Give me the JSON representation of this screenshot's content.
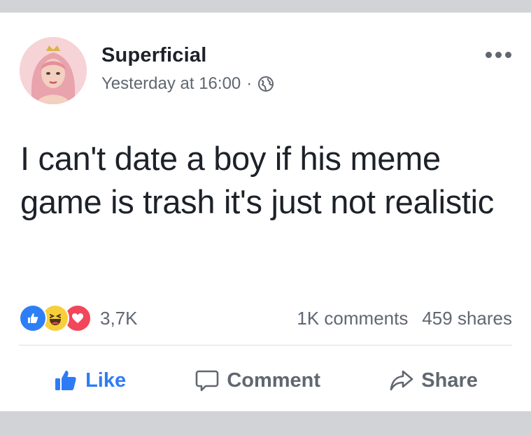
{
  "post": {
    "author": "Superficial",
    "timestamp": "Yesterday at 16:00",
    "separator": "·",
    "privacy_icon": "globe-icon",
    "more_icon": "more-options-icon",
    "text": "I can't date a boy if his meme game is trash it's just not realistic"
  },
  "reactions": {
    "icons": [
      "like-reaction-icon",
      "haha-reaction-icon",
      "love-reaction-icon"
    ],
    "count": "3,7K",
    "comments": "1K comments",
    "shares": "459 shares"
  },
  "actions": {
    "like_label": "Like",
    "comment_label": "Comment",
    "share_label": "Share"
  },
  "colors": {
    "accent": "#2d7cf6",
    "text": "#1d2129",
    "secondary": "#606770",
    "love": "#f2465a",
    "haha": "#f8cf3a",
    "background": "#d2d3d7"
  }
}
